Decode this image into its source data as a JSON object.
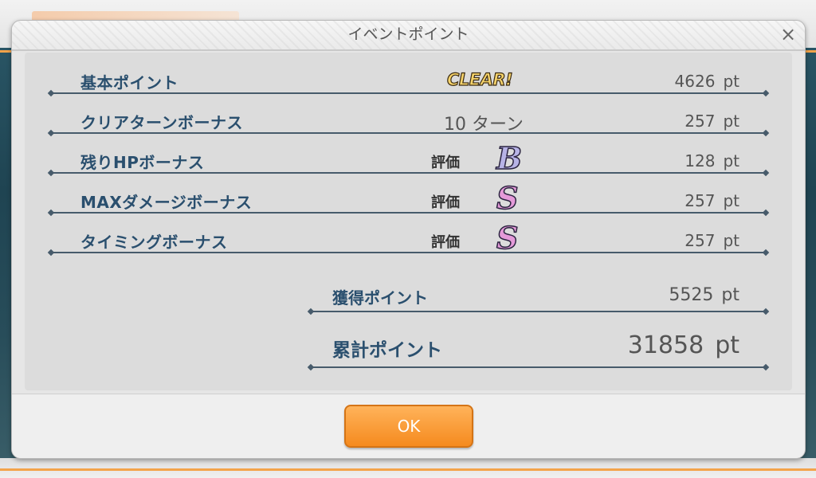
{
  "dialog": {
    "title": "イベントポイント",
    "close_icon": "×"
  },
  "rows": [
    {
      "label": "基本ポイント",
      "badge": "CLEAR!",
      "value": "4626",
      "unit": "pt"
    },
    {
      "label": "クリアターンボーナス",
      "turns": "10 ターン",
      "value": "257",
      "unit": "pt"
    },
    {
      "label": "残りHPボーナス",
      "rank_label": "評価",
      "rank": "B",
      "value": "128",
      "unit": "pt"
    },
    {
      "label": "MAXダメージボーナス",
      "rank_label": "評価",
      "rank": "S",
      "value": "257",
      "unit": "pt"
    },
    {
      "label": "タイミングボーナス",
      "rank_label": "評価",
      "rank": "S",
      "value": "257",
      "unit": "pt"
    }
  ],
  "summary": {
    "earned_label": "獲得ポイント",
    "earned_value": "5525",
    "earned_unit": "pt",
    "total_label": "累計ポイント",
    "total_value": "31858",
    "total_unit": "pt"
  },
  "footer": {
    "ok_label": "OK"
  },
  "colors": {
    "accent": "#f58a1e",
    "label": "#2a4f6e",
    "rank_b": "#b7b3e6",
    "rank_s": "#e59ad9"
  }
}
